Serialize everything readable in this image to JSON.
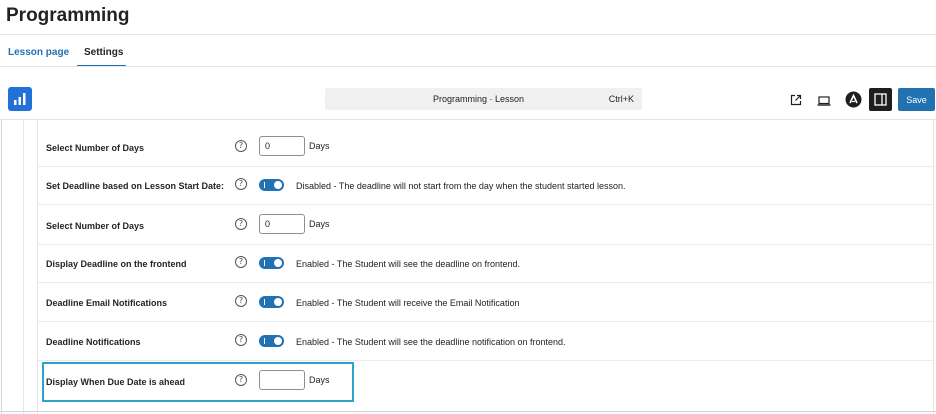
{
  "page": {
    "title": "Programming"
  },
  "tabs": [
    {
      "label": "Lesson page"
    },
    {
      "label": "Settings"
    }
  ],
  "toolbar": {
    "command_title": "Programming · Lesson",
    "command_shortcut": "Ctrl+K",
    "save_label": "Save",
    "icons": [
      "logo-bar-chart-icon",
      "external-link-icon",
      "view-desktop-icon",
      "astra-icon",
      "sidebar-toggle-icon"
    ]
  },
  "colors": {
    "accent": "#2271b1",
    "logo": "#2271d6",
    "highlight": "#2ea2cc",
    "dark": "#1e1e1e"
  },
  "settings": {
    "rows": [
      {
        "label": "Select Number of Days",
        "type": "number",
        "value": "0",
        "unit": "Days"
      },
      {
        "label": "Set Deadline based on Lesson Start Date:",
        "type": "toggle",
        "text": "Disabled - The deadline will not start from the day when the student started lesson."
      },
      {
        "label": "Select Number of Days",
        "type": "number",
        "value": "0",
        "unit": "Days"
      },
      {
        "label": "Display Deadline on the frontend",
        "type": "toggle",
        "text": "Enabled - The Student will see the deadline on frontend."
      },
      {
        "label": "Deadline Email Notifications",
        "type": "toggle",
        "text": "Enabled - The Student will receive the Email Notification"
      },
      {
        "label": "Deadline Notifications",
        "type": "toggle",
        "text": "Enabled - The Student will see the deadline notification on frontend."
      },
      {
        "label": "Display When Due Date is ahead",
        "type": "number",
        "value": "",
        "unit": "Days"
      }
    ],
    "help_glyph": "?"
  }
}
